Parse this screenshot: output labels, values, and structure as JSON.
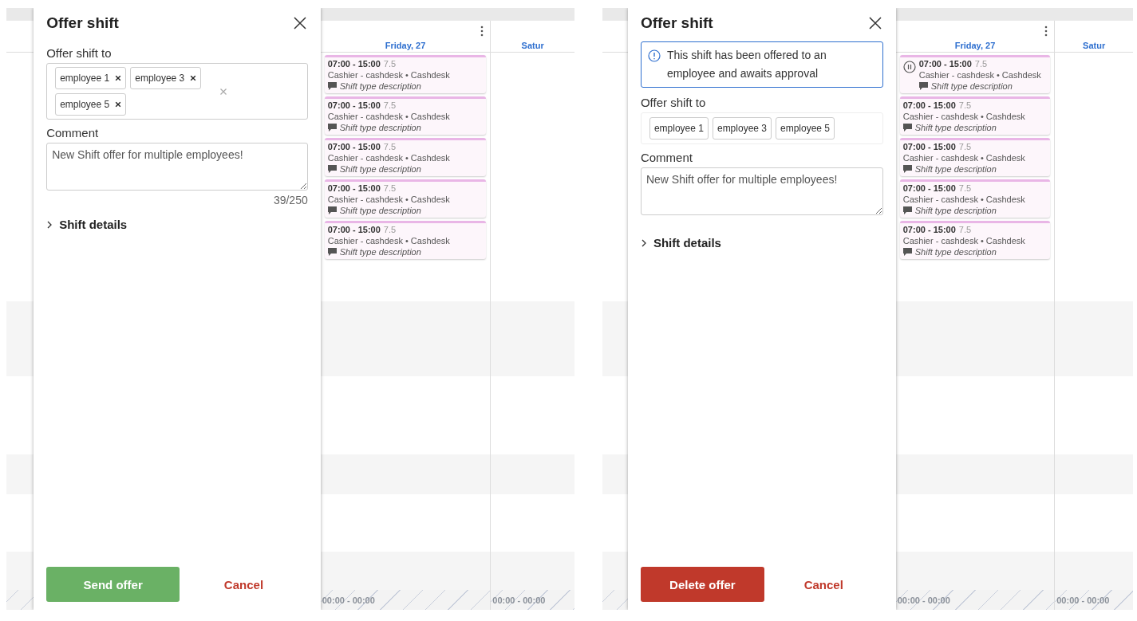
{
  "panels": [
    {
      "dialog": {
        "title": "Offer shift",
        "recipients_label": "Offer shift to",
        "recipients": [
          {
            "name": "employee 1",
            "removable": true
          },
          {
            "name": "employee 3",
            "removable": true
          },
          {
            "name": "employee 5",
            "removable": true
          }
        ],
        "clearable": true,
        "comment_label": "Comment",
        "comment": "New Shift offer for multiple employees!",
        "char_count": "39/250",
        "details_label": "Shift details",
        "details_expanded": false,
        "primary_action": {
          "label": "Send offer",
          "kind": "send"
        },
        "cancel_label": "Cancel"
      },
      "calendar": {
        "day_headers": [
          {
            "label": "Friday, 27"
          },
          {
            "label": "Satur"
          }
        ],
        "shifts": [
          {
            "time": "07:00 - 15:00",
            "hours": "7.5",
            "role": "Cashier - cashdesk • Cashdesk",
            "description": "Shift type description",
            "paused": false
          },
          {
            "time": "07:00 - 15:00",
            "hours": "7.5",
            "role": "Cashier - cashdesk • Cashdesk",
            "description": "Shift type description",
            "paused": false
          },
          {
            "time": "07:00 - 15:00",
            "hours": "7.5",
            "role": "Cashier - cashdesk • Cashdesk",
            "description": "Shift type description",
            "paused": false
          },
          {
            "time": "07:00 - 15:00",
            "hours": "7.5",
            "role": "Cashier - cashdesk • Cashdesk",
            "description": "Shift type description",
            "paused": false
          },
          {
            "time": "07:00 - 15:00",
            "hours": "7.5",
            "role": "Cashier - cashdesk • Cashdesk",
            "description": "Shift type description",
            "paused": false
          }
        ],
        "footer_times": [
          "00:00 - 00:00",
          "00:00 - 00:00"
        ]
      }
    },
    {
      "dialog": {
        "title": "Offer shift",
        "notice": "This shift has been offered to an employee and awaits approval",
        "recipients_label": "Offer shift to",
        "recipients": [
          {
            "name": "employee 1",
            "removable": false
          },
          {
            "name": "employee 3",
            "removable": false
          },
          {
            "name": "employee 5",
            "removable": false
          }
        ],
        "clearable": false,
        "comment_label": "Comment",
        "comment": "New Shift offer for multiple employees!",
        "details_label": "Shift details",
        "details_expanded": false,
        "primary_action": {
          "label": "Delete offer",
          "kind": "delete"
        },
        "cancel_label": "Cancel"
      },
      "calendar": {
        "day_headers": [
          {
            "label": "Friday, 27"
          },
          {
            "label": "Satur"
          }
        ],
        "shifts": [
          {
            "time": "07:00 - 15:00",
            "hours": "7.5",
            "role": "Cashier - cashdesk • Cashdesk",
            "description": "Shift type description",
            "paused": true
          },
          {
            "time": "07:00 - 15:00",
            "hours": "7.5",
            "role": "Cashier - cashdesk • Cashdesk",
            "description": "Shift type description",
            "paused": false
          },
          {
            "time": "07:00 - 15:00",
            "hours": "7.5",
            "role": "Cashier - cashdesk • Cashdesk",
            "description": "Shift type description",
            "paused": false
          },
          {
            "time": "07:00 - 15:00",
            "hours": "7.5",
            "role": "Cashier - cashdesk • Cashdesk",
            "description": "Shift type description",
            "paused": false
          },
          {
            "time": "07:00 - 15:00",
            "hours": "7.5",
            "role": "Cashier - cashdesk • Cashdesk",
            "description": "Shift type description",
            "paused": false
          }
        ],
        "footer_times": [
          "00:00 - 00:00",
          "00:00 - 00:00"
        ]
      }
    }
  ]
}
